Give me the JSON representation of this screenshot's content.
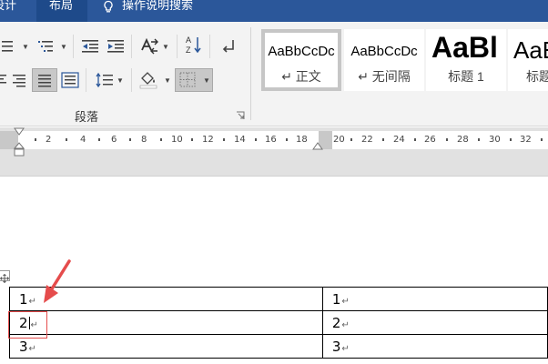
{
  "tabs": [
    {
      "label": "设计",
      "active": false
    },
    {
      "label": "布局",
      "active": true
    }
  ],
  "tell_me": {
    "label": "操作说明搜索",
    "icon": "lightbulb-icon"
  },
  "paragraph_group": {
    "label": "段落",
    "tools": [
      {
        "name": "bullets",
        "icon": "bullet-list-icon"
      },
      {
        "name": "multilevel",
        "icon": "multilevel-list-icon"
      },
      {
        "name": "decrease-indent",
        "icon": "decrease-indent-icon"
      },
      {
        "name": "increase-indent",
        "icon": "increase-indent-icon"
      },
      {
        "name": "chinese-layout",
        "icon": "chinese-layout-icon"
      },
      {
        "name": "sort",
        "icon": "sort-icon"
      },
      {
        "name": "show-marks",
        "icon": "paragraph-mark-icon"
      },
      {
        "name": "align-right",
        "icon": "align-right-icon"
      },
      {
        "name": "justify",
        "icon": "justify-icon",
        "pressed": true
      },
      {
        "name": "distributed",
        "icon": "distributed-icon"
      },
      {
        "name": "line-spacing",
        "icon": "line-spacing-icon"
      },
      {
        "name": "shading",
        "icon": "shading-icon"
      },
      {
        "name": "borders",
        "icon": "borders-icon",
        "pressed": true
      }
    ]
  },
  "styles": [
    {
      "sample": "AaBbCcDc",
      "name": "↵ 正文",
      "selected": true,
      "size": "small"
    },
    {
      "sample": "AaBbCcDc",
      "name": "↵ 无间隔",
      "selected": false,
      "size": "small"
    },
    {
      "sample": "AaBl",
      "name": "标题 1",
      "selected": false,
      "size": "large"
    },
    {
      "sample": "AaE",
      "name": "标题",
      "selected": false,
      "size": "medium"
    }
  ],
  "ruler": {
    "labels": [
      "2",
      "4",
      "6",
      "8",
      "10",
      "12",
      "14",
      "16",
      "18",
      "20",
      "22",
      "24",
      "26",
      "28",
      "30",
      "32"
    ]
  },
  "table": {
    "rows": [
      [
        "1",
        "1"
      ],
      [
        "2",
        "2"
      ],
      [
        "3",
        "3"
      ]
    ],
    "cell_mark": "↵"
  },
  "colors": {
    "tab_bar": "#2b579a",
    "annotation": "#e54c4c"
  }
}
